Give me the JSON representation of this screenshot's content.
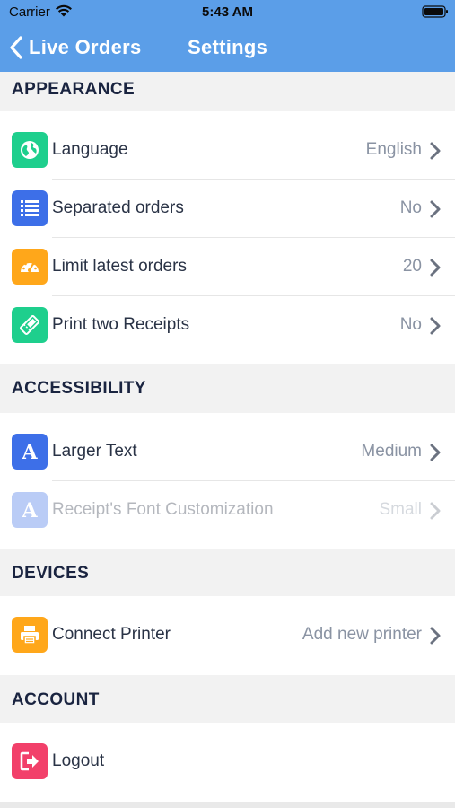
{
  "status_bar": {
    "carrier": "Carrier",
    "time": "5:43 AM"
  },
  "nav": {
    "back_label": "Live Orders",
    "title": "Settings"
  },
  "colors": {
    "nav_bg": "#5b9ee8",
    "green": "#1ecf8d",
    "blue": "#3d6fe8",
    "orange": "#ffa71a",
    "pink": "#f2406a"
  },
  "sections": {
    "appearance": {
      "header": "APPEARANCE",
      "rows": [
        {
          "label": "Language",
          "value": "English",
          "icon": "globe-icon"
        },
        {
          "label": "Separated orders",
          "value": "No",
          "icon": "list-icon"
        },
        {
          "label": "Limit latest orders",
          "value": "20",
          "icon": "gauge-icon"
        },
        {
          "label": "Print two Receipts",
          "value": "No",
          "icon": "ticket-icon"
        }
      ]
    },
    "accessibility": {
      "header": "ACCESSIBILITY",
      "rows": [
        {
          "label": "Larger Text",
          "value": "Medium",
          "icon": "font-icon"
        },
        {
          "label": "Receipt's Font Customization",
          "value": "Small",
          "icon": "font-icon",
          "disabled": true
        }
      ]
    },
    "devices": {
      "header": "DEVICES",
      "rows": [
        {
          "label": "Connect Printer",
          "value": "Add new printer",
          "icon": "printer-icon"
        }
      ]
    },
    "account": {
      "header": "ACCOUNT",
      "rows": [
        {
          "label": "Logout",
          "icon": "logout-icon"
        }
      ]
    }
  }
}
